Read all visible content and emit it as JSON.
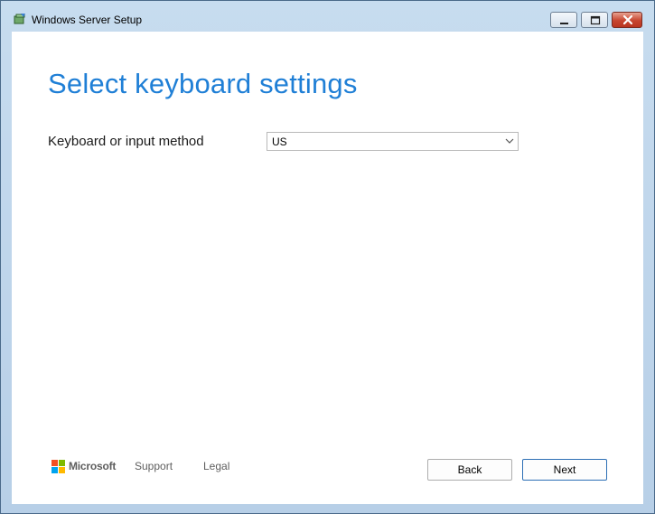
{
  "window": {
    "title": "Windows Server Setup",
    "icon": "setup-icon",
    "controls": [
      "minimize-icon",
      "maximize-icon",
      "close-icon"
    ]
  },
  "page": {
    "heading": "Select keyboard settings"
  },
  "keyboard": {
    "label": "Keyboard or input method",
    "selected": "US",
    "icon": "chevron-down-icon"
  },
  "footer": {
    "brand": "Microsoft",
    "support": "Support",
    "legal": "Legal",
    "back": "Back",
    "next": "Next"
  },
  "colors": {
    "accent": "#1f7fd6",
    "next_border": "#2d6fb5",
    "close_red": "#c7452f",
    "ms_red": "#f25022",
    "ms_green": "#7fba00",
    "ms_blue": "#00a4ef",
    "ms_yellow": "#ffb900"
  }
}
